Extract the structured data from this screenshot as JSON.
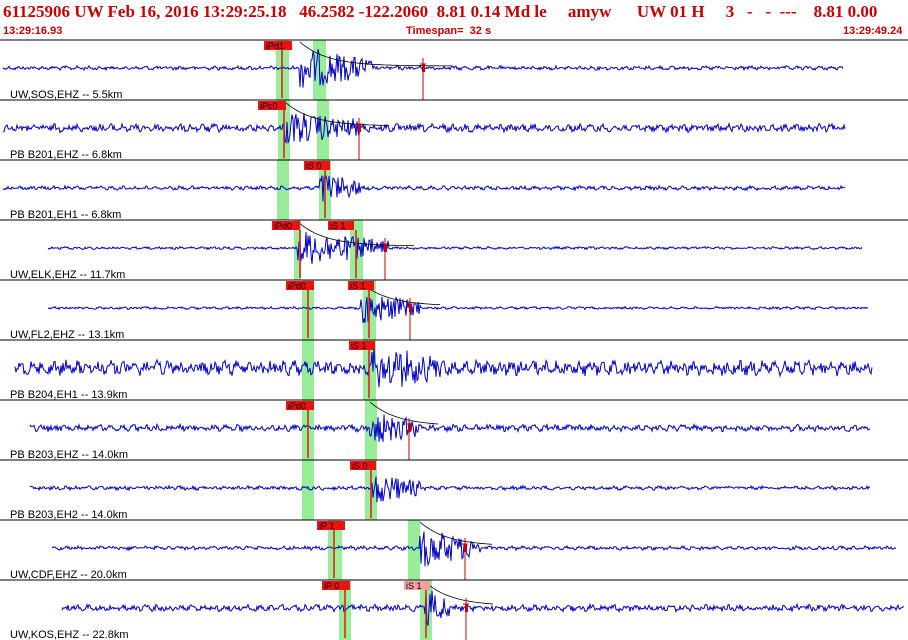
{
  "header": {
    "title": "61125906 UW Feb 16, 2016 13:29:25.18   46.2582 -122.2060  8.81 0.14 Md le     amyw      UW 01 H     3   -   -  ---    8.81 0.00",
    "start_time": "13:29:16.93",
    "timespan": "Timespan=  32 s",
    "end_time": "13:29:49.24"
  },
  "colors": {
    "title": "#cc0000",
    "trace": "#0000cc",
    "pick_box": "#ee1111",
    "pick_box_light": "#f4a0a0",
    "window_shade": "#98ee98",
    "separator": "#000000",
    "coda": "#cc0000"
  },
  "traces": [
    {
      "label": "UW,SOS,EHZ -- 5.5km",
      "amp": 3,
      "p_pick": "iPd1",
      "s_pick": "",
      "coda_mark": true
    },
    {
      "label": "PB B201,EHZ -- 6.8km",
      "amp": 6,
      "p_pick": "iPc0",
      "s_pick": "",
      "coda_mark": true
    },
    {
      "label": "PB B201,EH1 -- 6.8km",
      "amp": 3,
      "p_pick": "",
      "s_pick": "iS 0",
      "coda_mark": false
    },
    {
      "label": "UW,ELK,EHZ -- 11.7km",
      "amp": 2,
      "p_pick": "iPd0",
      "s_pick": "iS 1",
      "coda_mark": true
    },
    {
      "label": "UW,FL2,EHZ -- 13.1km",
      "amp": 2,
      "p_pick": "iPd0",
      "s_pick": "iS 1",
      "coda_mark": true
    },
    {
      "label": "PB B204,EH1 -- 13.9km",
      "amp": 11,
      "p_pick": "",
      "s_pick": "iS 1",
      "coda_mark": false
    },
    {
      "label": "PB B203,EHZ -- 14.0km",
      "amp": 5,
      "p_pick": "iPd0",
      "s_pick": "",
      "coda_mark": true
    },
    {
      "label": "PB B203,EH2 -- 14.0km",
      "amp": 3,
      "p_pick": "",
      "s_pick": "iS 0",
      "coda_mark": false
    },
    {
      "label": "UW,CDF,EHZ -- 20.0km",
      "amp": 3,
      "p_pick": "iP 1",
      "s_pick": "",
      "coda_mark": true
    },
    {
      "label": "UW,KOS,EHZ -- 22.8km",
      "amp": 5,
      "p_pick": "iP 0",
      "s_pick": "iS 1",
      "coda_mark": true
    }
  ]
}
